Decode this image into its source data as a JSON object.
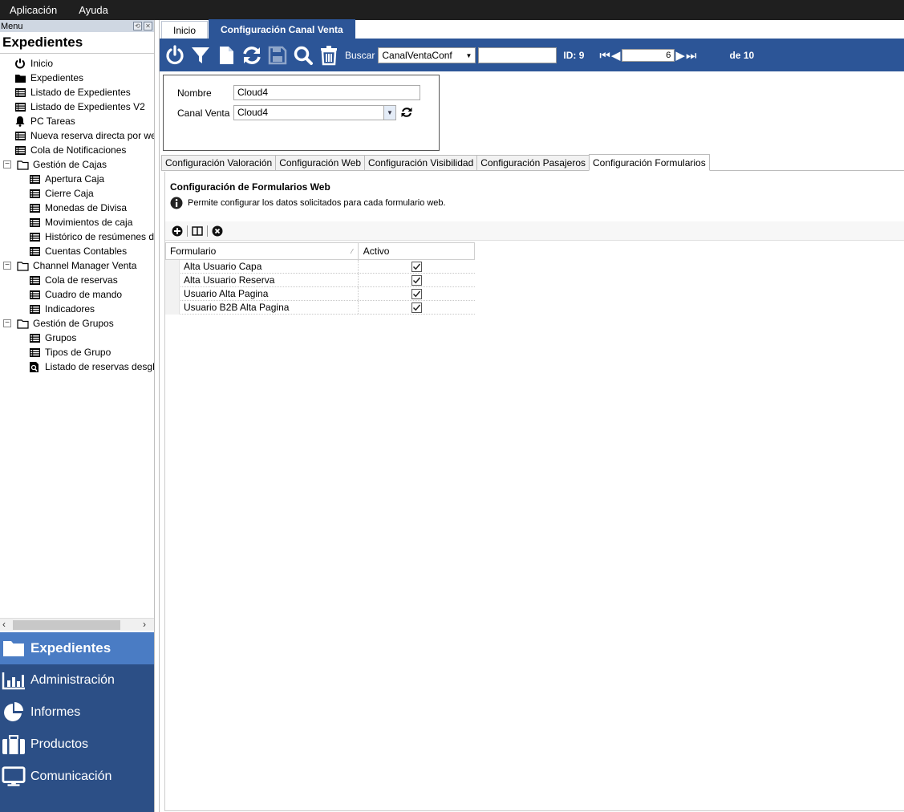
{
  "menubar": {
    "items": [
      "Aplicación",
      "Ayuda"
    ]
  },
  "left_panel": {
    "header_label": "Menu",
    "title": "Expedientes",
    "tree": [
      {
        "label": "Inicio",
        "icon": "power-icon",
        "level": 0
      },
      {
        "label": "Expedientes",
        "icon": "folder-icon",
        "level": 0
      },
      {
        "label": "Listado de Expedientes",
        "icon": "list-icon",
        "level": 0
      },
      {
        "label": "Listado de Expedientes V2",
        "icon": "list-icon",
        "level": 0
      },
      {
        "label": "PC Tareas",
        "icon": "bell-icon",
        "level": 0
      },
      {
        "label": "Nueva reserva directa por we",
        "icon": "list-icon",
        "level": 0
      },
      {
        "label": "Cola de Notificaciones",
        "icon": "list-icon",
        "level": 0
      },
      {
        "label": "Gestión de Cajas",
        "icon": "folder-outline-icon",
        "level": 0,
        "expander": "⊟"
      },
      {
        "label": "Apertura Caja",
        "icon": "list-icon",
        "level": 1
      },
      {
        "label": "Cierre Caja",
        "icon": "list-icon",
        "level": 1
      },
      {
        "label": "Monedas de Divisa",
        "icon": "list-icon",
        "level": 1
      },
      {
        "label": "Movimientos de caja",
        "icon": "list-icon",
        "level": 1
      },
      {
        "label": "Histórico de resúmenes d",
        "icon": "list-icon",
        "level": 1
      },
      {
        "label": "Cuentas Contables",
        "icon": "list-icon",
        "level": 1
      },
      {
        "label": "Channel Manager Venta",
        "icon": "folder-outline-icon",
        "level": 0,
        "expander": "⊟"
      },
      {
        "label": "Cola de reservas",
        "icon": "list-icon",
        "level": 1
      },
      {
        "label": "Cuadro de mando",
        "icon": "list-icon",
        "level": 1
      },
      {
        "label": "Indicadores",
        "icon": "list-icon",
        "level": 1
      },
      {
        "label": "Gestión de Grupos",
        "icon": "folder-outline-icon",
        "level": 0,
        "expander": "⊟"
      },
      {
        "label": "Grupos",
        "icon": "list-icon",
        "level": 1
      },
      {
        "label": "Tipos de Grupo",
        "icon": "list-icon",
        "level": 1
      },
      {
        "label": "Listado de reservas desgl",
        "icon": "search-doc-icon",
        "level": 1
      }
    ],
    "nav": [
      {
        "label": "Expedientes",
        "icon": "folder-icon",
        "active": true
      },
      {
        "label": "Administración",
        "icon": "bar-chart-icon",
        "active": false
      },
      {
        "label": "Informes",
        "icon": "pie-chart-icon",
        "active": false
      },
      {
        "label": "Productos",
        "icon": "briefcase-icon",
        "active": false
      },
      {
        "label": "Comunicación",
        "icon": "monitor-icon",
        "active": false
      }
    ]
  },
  "doc_tabs": [
    {
      "label": "Inicio",
      "active": false
    },
    {
      "label": "Configuración Canal Venta",
      "active": true
    }
  ],
  "toolbar": {
    "buscar_label": "Buscar",
    "buscar_value": "CanalVentaConf",
    "buscar_text": "",
    "id_label": "ID: 9",
    "record_position": "6",
    "record_total": "de 10"
  },
  "form": {
    "nombre_label": "Nombre",
    "nombre_value": "Cloud4",
    "canal_label": "Canal Venta",
    "canal_value": "Cloud4"
  },
  "sub_tabs": [
    {
      "label": "Configuración Valoración",
      "active": false
    },
    {
      "label": "Configuración Web",
      "active": false
    },
    {
      "label": "Configuración Visibilidad",
      "active": false
    },
    {
      "label": "Configuración Pasajeros",
      "active": false
    },
    {
      "label": "Configuración Formularios",
      "active": true
    }
  ],
  "section": {
    "title": "Configuración de Formularios Web",
    "description": "Permite configurar los datos solicitados para cada formulario web."
  },
  "grid": {
    "columns": [
      "Formulario",
      "Activo"
    ],
    "rows": [
      {
        "formulario": "Alta Usuario Capa",
        "activo": true
      },
      {
        "formulario": "Alta Usuario Reserva",
        "activo": true
      },
      {
        "formulario": "Usuario Alta Pagina",
        "activo": true
      },
      {
        "formulario": "Usuario B2B Alta Pagina",
        "activo": true
      }
    ]
  },
  "colors": {
    "accent": "#2c5597",
    "nav_bg": "#2c4f86",
    "nav_active": "#4a7cc4",
    "menubar": "#1f1f1f"
  }
}
